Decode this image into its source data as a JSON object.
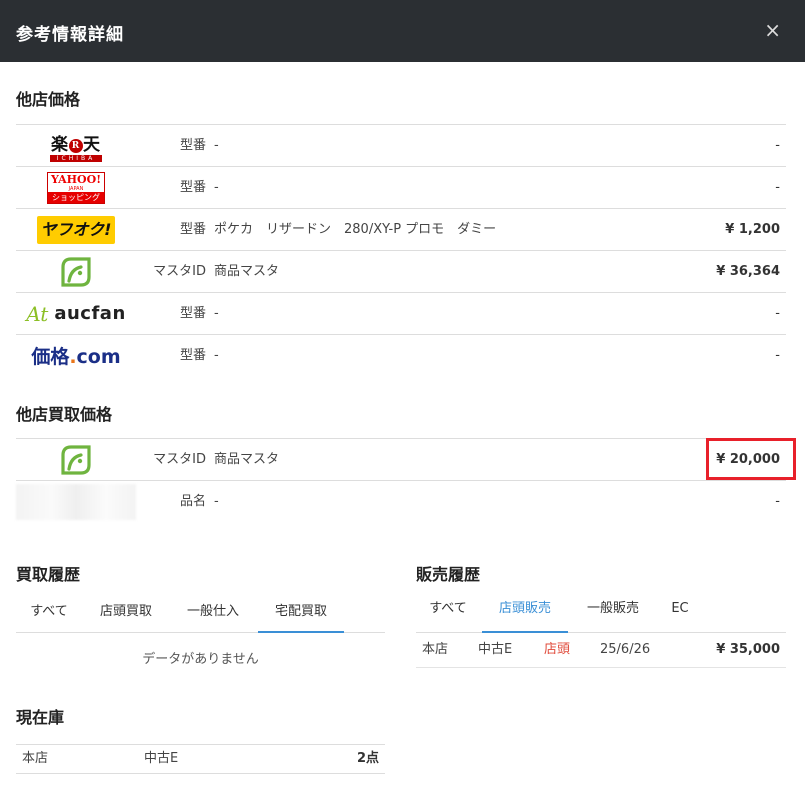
{
  "header": {
    "title": "参考情報詳細",
    "close": "×"
  },
  "other_prices": {
    "title": "他店価格",
    "rows": [
      {
        "logo": "rakuten-logo",
        "label": "型番",
        "value": "-",
        "price": "-"
      },
      {
        "logo": "yahoo-shopping-logo",
        "label": "型番",
        "value": "-",
        "price": "-"
      },
      {
        "logo": "yafuoku-logo",
        "label": "型番",
        "value": "ポケカ　リザードン　280/XY-P プロモ　ダミー",
        "price": "¥ 1,200"
      },
      {
        "logo": "leaf-logo",
        "label": "マスタID",
        "value": "商品マスタ",
        "price": "¥ 36,364"
      },
      {
        "logo": "aucfan-logo",
        "label": "型番",
        "value": "-",
        "price": "-"
      },
      {
        "logo": "kakaku-logo",
        "label": "型番",
        "value": "-",
        "price": "-"
      }
    ]
  },
  "logos": {
    "rakuten_top": "楽天",
    "rakuten_sub": "ICHIBA",
    "yahoo_l1": "YAHOO!",
    "yahoo_l2": "JAPAN",
    "yahoo_l3": "ショッピング",
    "yafuoku": "ヤフオク!",
    "aucfan": "aucfan",
    "kakaku_main": "価格",
    "kakaku_dot": ".",
    "kakaku_com": "com"
  },
  "buy_prices": {
    "title": "他店買取価格",
    "rows": [
      {
        "logo": "leaf-logo",
        "label": "マスタID",
        "value": "商品マスタ",
        "price": "¥ 20,000"
      },
      {
        "logo": "blurred-logo",
        "label": "品名",
        "value": "-",
        "price": "-"
      }
    ]
  },
  "purchase_history": {
    "title": "買取履歴",
    "tabs": [
      "すべて",
      "店頭買取",
      "一般仕入",
      "宅配買取"
    ],
    "active_tab": "宅配買取",
    "empty_text": "データがありません"
  },
  "sales_history": {
    "title": "販売履歴",
    "tabs": [
      "すべて",
      "店頭販売",
      "一般販売",
      "EC"
    ],
    "active_tab": "店頭販売",
    "rows": [
      {
        "store": "本店",
        "grade": "中古E",
        "channel": "店頭",
        "date": "25/6/26",
        "price": "¥ 35,000"
      }
    ]
  },
  "stock": {
    "title": "現在庫",
    "rows": [
      {
        "store": "本店",
        "grade": "中古E",
        "qty": "2点"
      }
    ]
  },
  "colors": {
    "header_bg": "#2b2f33",
    "accent_blue": "#3a8fd6",
    "highlight_red": "#e8202a",
    "channel_red": "#e04a3a",
    "leaf_green": "#6fb43f"
  }
}
